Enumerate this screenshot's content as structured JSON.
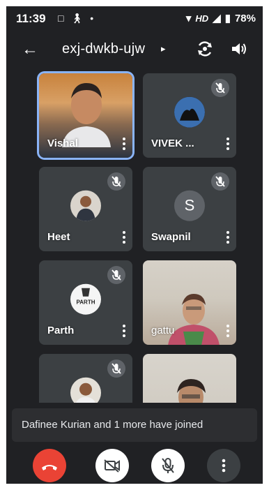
{
  "status_bar": {
    "time": "11:39",
    "network": "HD",
    "battery": "78%"
  },
  "header": {
    "meeting_code": "exj-dwkb-ujw",
    "caret": "▸"
  },
  "participants": [
    {
      "name": "Vishal",
      "muted": false,
      "active": true
    },
    {
      "name": "VIVEK ...",
      "muted": true
    },
    {
      "name": "Heet",
      "muted": true
    },
    {
      "name": "Swapnil",
      "muted": true,
      "avatar_letter": "S"
    },
    {
      "name": "Parth",
      "muted": true,
      "avatar_text": "PARTH"
    },
    {
      "name": "gattu",
      "muted": false
    },
    {
      "name": "",
      "muted": true
    },
    {
      "name": "",
      "muted": false
    }
  ],
  "toast": {
    "message": "Dafinee Kurian and 1 more have joined"
  },
  "colors": {
    "end_call": "#ea4335",
    "active_border": "#8ab4f8",
    "background": "#202124",
    "tile": "#3c4043"
  }
}
